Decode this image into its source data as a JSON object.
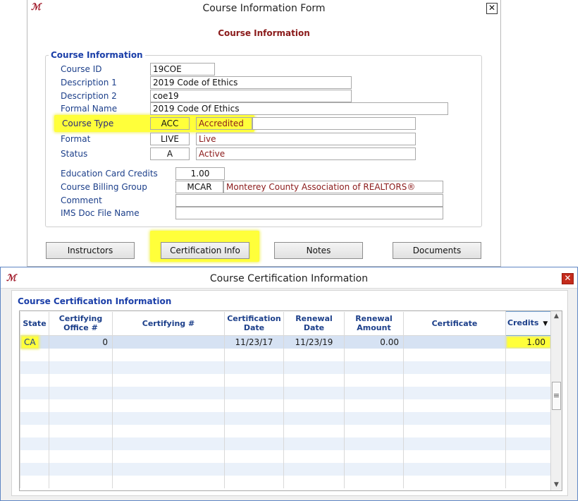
{
  "course_window": {
    "title": "Course Information Form",
    "heading": "Course Information",
    "group_title": "Course Information",
    "fields": {
      "course_id": {
        "label": "Course ID",
        "value": "19COE"
      },
      "description1": {
        "label": "Description 1",
        "value": "2019 Code of Ethics"
      },
      "description2": {
        "label": "Description 2",
        "value": "coe19"
      },
      "formal_name": {
        "label": "Formal Name",
        "value": "2019 Code Of Ethics"
      },
      "course_type": {
        "label": "Course Type",
        "code": "ACC",
        "desc": "Accredited"
      },
      "format": {
        "label": "Format",
        "code": "LIVE",
        "desc": "Live"
      },
      "status": {
        "label": "Status",
        "code": "A",
        "desc": "Active"
      },
      "education_card_credits": {
        "label": "Education Card Credits",
        "value": "1.00"
      },
      "course_billing_group": {
        "label": "Course Billing Group",
        "code": "MCAR",
        "desc": "Monterey County Association of REALTORS®"
      },
      "comment": {
        "label": "Comment",
        "value": ""
      },
      "ims_doc_file_name": {
        "label": "IMS Doc File Name",
        "value": ""
      }
    },
    "buttons": {
      "instructors": "Instructors",
      "certification_info": "Certification Info",
      "notes": "Notes",
      "documents": "Documents"
    },
    "app_icon_glyph": "ℳ",
    "close_glyph": "✕"
  },
  "cert_window": {
    "title": "Course Certification Information",
    "section_title": "Course Certification Information",
    "columns": [
      "State",
      "Certifying Office #",
      "Certifying #",
      "Certification Date",
      "Renewal Date",
      "Renewal Amount",
      "Certificate",
      "Credits"
    ],
    "rows": [
      {
        "state": "CA",
        "certifying_office": "0",
        "certifying_num": "",
        "certification_date": "11/23/17",
        "renewal_date": "11/23/19",
        "renewal_amount": "0.00",
        "certificate": "",
        "credits": "1.00"
      }
    ],
    "sort_indicator": "▼",
    "app_icon_glyph": "ℳ",
    "close_glyph": "✕"
  },
  "colors": {
    "highlight": "#ffff3a",
    "label_blue": "#1c3f8a",
    "value_red": "#8b1a1a",
    "close_red": "#c42b1c"
  }
}
